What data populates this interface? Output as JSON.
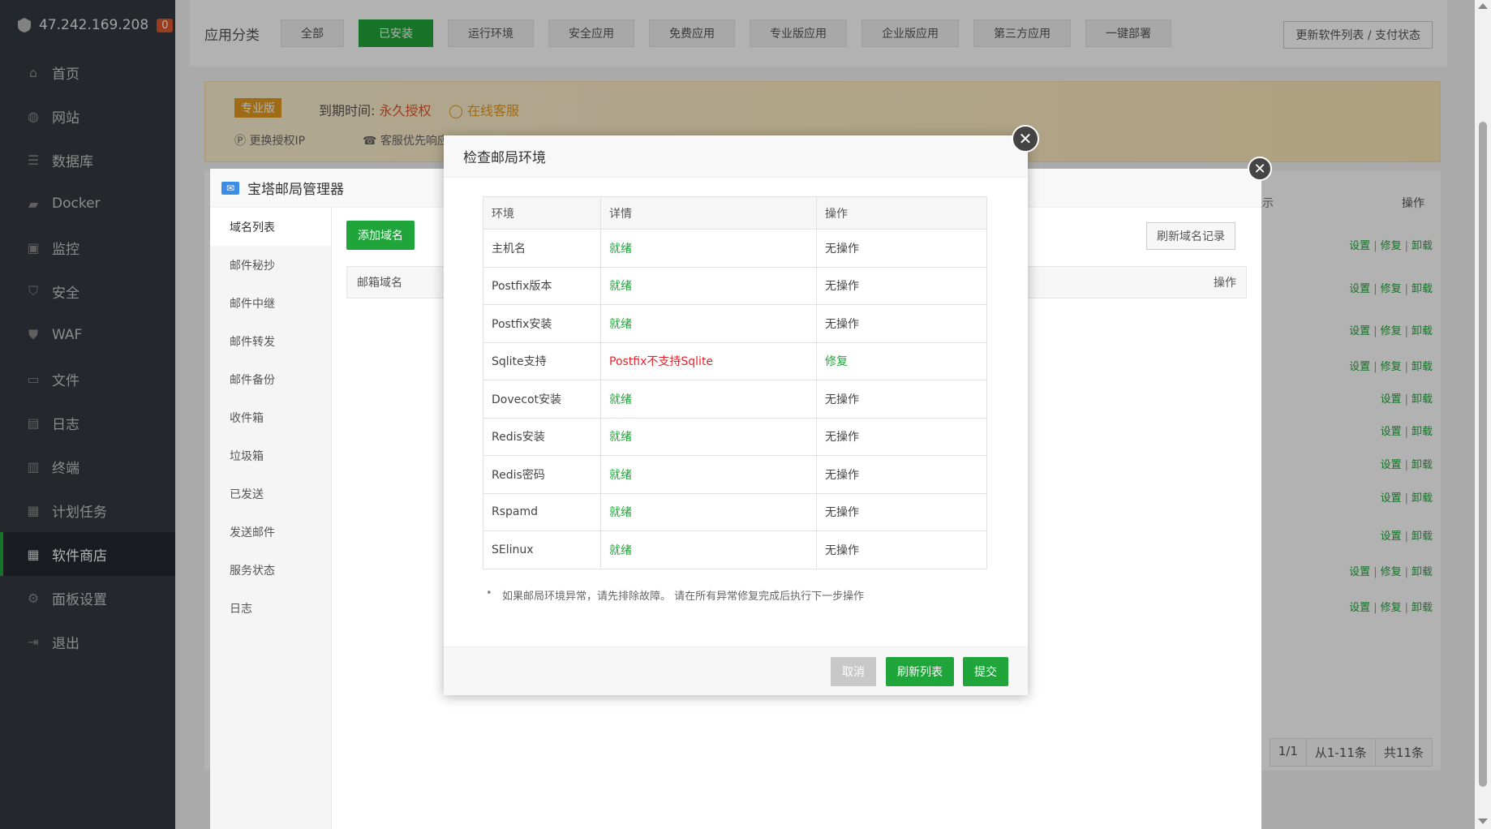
{
  "sidebar": {
    "ip": "47.242.169.208",
    "badge": "0",
    "items": [
      {
        "label": "首页",
        "icon": "home-icon"
      },
      {
        "label": "网站",
        "icon": "globe-icon"
      },
      {
        "label": "数据库",
        "icon": "database-icon"
      },
      {
        "label": "Docker",
        "icon": "docker-icon"
      },
      {
        "label": "监控",
        "icon": "monitor-icon"
      },
      {
        "label": "安全",
        "icon": "shield-icon"
      },
      {
        "label": "WAF",
        "icon": "waf-shield-icon"
      },
      {
        "label": "文件",
        "icon": "folder-icon"
      },
      {
        "label": "日志",
        "icon": "log-icon"
      },
      {
        "label": "终端",
        "icon": "terminal-icon"
      },
      {
        "label": "计划任务",
        "icon": "calendar-icon"
      },
      {
        "label": "软件商店",
        "icon": "grid-icon"
      },
      {
        "label": "面板设置",
        "icon": "gear-icon"
      },
      {
        "label": "退出",
        "icon": "logout-icon"
      }
    ],
    "active_index": 11
  },
  "categories": {
    "label": "应用分类",
    "buttons": [
      "全部",
      "已安装",
      "运行环境",
      "安全应用",
      "免费应用",
      "专业版应用",
      "企业版应用",
      "第三方应用",
      "一键部署"
    ],
    "active": "已安装",
    "refresh_label": "更新软件列表 / 支付状态"
  },
  "pro_banner": {
    "tag": "专业版",
    "expire_label": "到期时间:",
    "expire_value": "永久授权",
    "service": "在线客服",
    "change_ip": "更换授权IP",
    "priority": "客服优先响应"
  },
  "bg_table": {
    "header_hint": "提示",
    "header_ops": "操作",
    "ops_set": "设置",
    "ops_fix": "修复",
    "ops_uninstall": "卸载",
    "pager": [
      "1/1",
      "从1-11条",
      "共11条"
    ]
  },
  "mail_modal": {
    "title": "宝塔邮局管理器",
    "tabs": [
      "域名列表",
      "邮件秘抄",
      "邮件中继",
      "邮件转发",
      "邮件备份",
      "收件箱",
      "垃圾箱",
      "已发送",
      "发送邮件",
      "服务状态",
      "日志"
    ],
    "add_domain": "添加域名",
    "refresh_domain": "刷新域名记录",
    "col_domain": "邮箱域名",
    "col_ops": "操作"
  },
  "env_modal": {
    "title": "检查邮局环境",
    "columns": [
      "环境",
      "详情",
      "操作"
    ],
    "rows": [
      {
        "env": "主机名",
        "detail": "就绪",
        "op": "无操作",
        "status": "ok"
      },
      {
        "env": "Postfix版本",
        "detail": "就绪",
        "op": "无操作",
        "status": "ok"
      },
      {
        "env": "Postfix安装",
        "detail": "就绪",
        "op": "无操作",
        "status": "ok"
      },
      {
        "env": "Sqlite支持",
        "detail": "Postfix不支持Sqlite",
        "op": "修复",
        "status": "err"
      },
      {
        "env": "Dovecot安装",
        "detail": "就绪",
        "op": "无操作",
        "status": "ok"
      },
      {
        "env": "Redis安装",
        "detail": "就绪",
        "op": "无操作",
        "status": "ok"
      },
      {
        "env": "Redis密码",
        "detail": "就绪",
        "op": "无操作",
        "status": "ok"
      },
      {
        "env": "Rspamd",
        "detail": "就绪",
        "op": "无操作",
        "status": "ok"
      },
      {
        "env": "SElinux",
        "detail": "就绪",
        "op": "无操作",
        "status": "ok"
      }
    ],
    "note": "如果邮局环境异常，请先排除故障。 请在所有异常修复完成后执行下一步操作",
    "cancel": "取消",
    "refresh": "刷新列表",
    "submit": "提交"
  },
  "colors": {
    "accent": "#20a53a",
    "error": "#e8222b",
    "sidebar_bg": "#343a41"
  }
}
